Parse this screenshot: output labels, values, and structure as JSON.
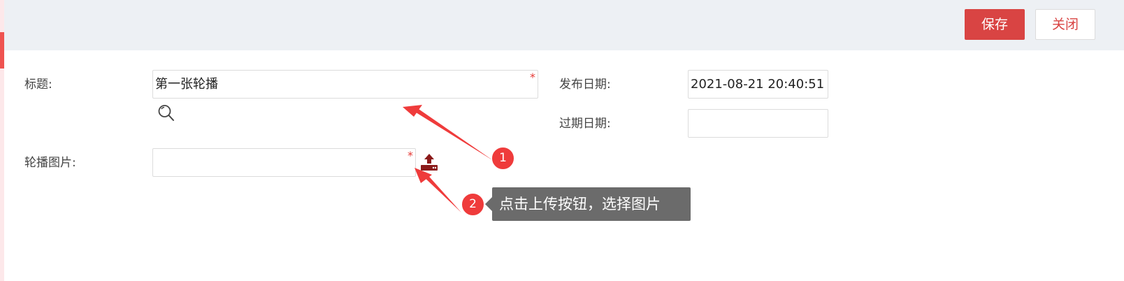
{
  "toolbar": {
    "save_label": "保存",
    "close_label": "关闭"
  },
  "form": {
    "title": {
      "label": "标题:",
      "value": "第一张轮播",
      "required_mark": "*"
    },
    "publish_date": {
      "label": "发布日期:",
      "value": "2021-08-21 20:40:51"
    },
    "expire_date": {
      "label": "过期日期:",
      "value": ""
    },
    "carousel_image": {
      "label": "轮播图片:",
      "value": "",
      "required_mark": "*"
    }
  },
  "annotations": {
    "step1": "1",
    "step2": "2",
    "tooltip": "点击上传按钮，选择图片"
  },
  "colors": {
    "accent_red": "#d94443",
    "annotation_red": "#ef3b3b",
    "tooltip_bg": "#6b6b6b",
    "toolbar_bg": "#edf0f4"
  },
  "icons": {
    "search": "magnifier-icon",
    "upload": "upload-icon"
  }
}
